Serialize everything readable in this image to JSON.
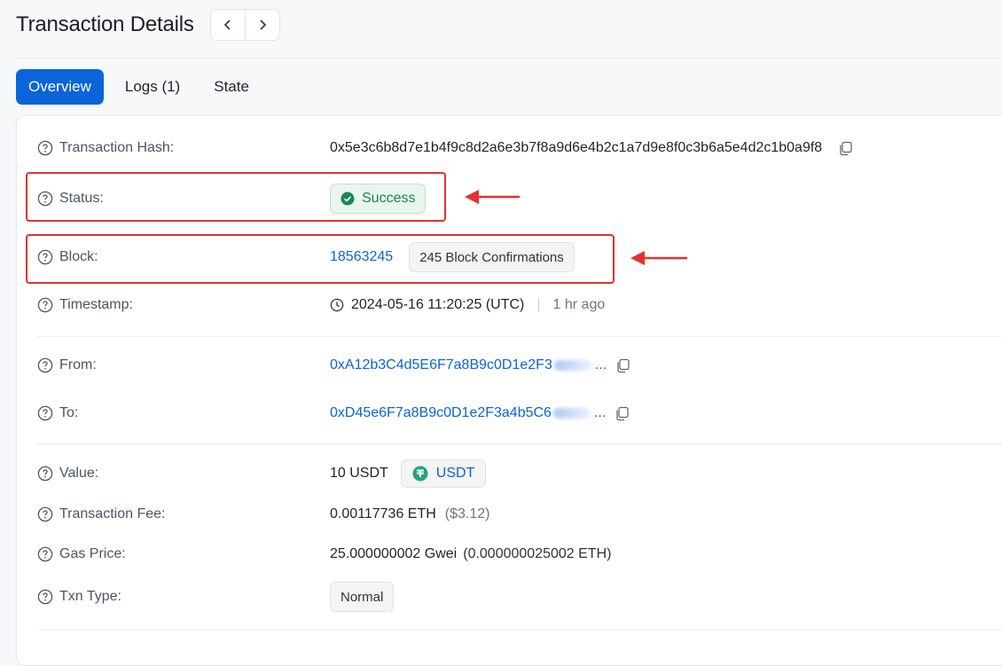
{
  "header": {
    "title": "Transaction Details",
    "prev_label": "‹",
    "next_label": "›"
  },
  "tabs": [
    {
      "label": "Overview",
      "active": true
    },
    {
      "label": "Logs (1)",
      "active": false
    },
    {
      "label": "State",
      "active": false
    }
  ],
  "details": {
    "tx_hash": {
      "label": "Transaction Hash:",
      "value": "0x5e3c6b8d7e1b4f9c8d2a6e3b7f8a9d6e4b2c1a7d9e8f0c3b6a5e4d2c1b0a9f8"
    },
    "status": {
      "label": "Status:",
      "value": "Success"
    },
    "block": {
      "label": "Block:",
      "value": "18563245",
      "confirmations": "245 Block Confirmations"
    },
    "timestamp": {
      "label": "Timestamp:",
      "value": "2024-05-16 11:20:25 (UTC)",
      "relative": "1 hr ago"
    },
    "from": {
      "label": "From:",
      "value": "0xA12b3C4d5E6F7a8B9c0D1e2F3",
      "ellipsis": "..."
    },
    "to": {
      "label": "To:",
      "value": "0xD45e6F7a8B9c0D1e2F3a4b5C6",
      "ellipsis": "..."
    },
    "value": {
      "label": "Value:",
      "amount": "10 USDT",
      "token": "USDT"
    },
    "fee": {
      "label": "Transaction Fee:",
      "value": "0.00117736 ETH",
      "usd": "($3.12)"
    },
    "gas_price": {
      "label": "Gas Price:",
      "value": "25.000000002 Gwei",
      "eth": "(0.000000025002 ETH)"
    },
    "txn_type": {
      "label": "Txn Type:",
      "value": "Normal"
    }
  },
  "colors": {
    "accent": "#0b65d8",
    "success": "#198754",
    "annotation": "#e5302d",
    "tether": "#26a17b"
  },
  "icons": [
    "chevron-left-icon",
    "chevron-right-icon",
    "help-circle-icon",
    "copy-icon",
    "check-circle-icon",
    "clock-icon",
    "tether-icon",
    "arrow-left-icon"
  ]
}
